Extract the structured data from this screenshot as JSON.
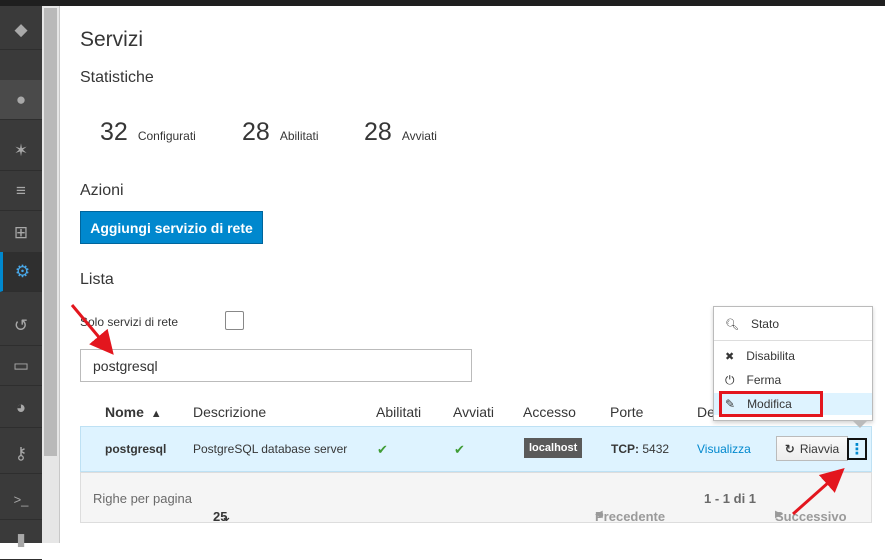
{
  "sidebar": {
    "items": [
      {
        "icon": "cube-icon",
        "glyph": "◆"
      },
      {
        "icon": "users-icon",
        "glyph": "●"
      },
      {
        "icon": "network-icon",
        "glyph": "✶"
      },
      {
        "icon": "database-icon",
        "glyph": "≡"
      },
      {
        "icon": "sitemap-icon",
        "glyph": "⊞"
      },
      {
        "icon": "gears-icon",
        "glyph": "⚙"
      },
      {
        "icon": "history-icon",
        "glyph": "↺"
      },
      {
        "icon": "drive-icon",
        "glyph": "▭"
      },
      {
        "icon": "pie-chart-icon",
        "glyph": "◕"
      },
      {
        "icon": "key-icon",
        "glyph": "⚷"
      },
      {
        "icon": "terminal-icon",
        "glyph": ">_"
      },
      {
        "icon": "document-icon",
        "glyph": "▮"
      }
    ]
  },
  "page": {
    "title": "Servizi",
    "stats_heading": "Statistiche",
    "actions_heading": "Azioni",
    "list_heading": "Lista"
  },
  "stats": [
    {
      "value": "32",
      "label": "Configurati"
    },
    {
      "value": "28",
      "label": "Abilitati"
    },
    {
      "value": "28",
      "label": "Avviati"
    }
  ],
  "actions": {
    "add_network_service": "Aggiungi servizio di rete"
  },
  "filters": {
    "network_only_label": "Solo servizi di rete",
    "search_value": "postgresql"
  },
  "table": {
    "headers": {
      "name": "Nome",
      "sort_indicator": "▲",
      "description": "Descrizione",
      "enabled": "Abilitati",
      "started": "Avviati",
      "access": "Accesso",
      "ports": "Porte",
      "details": "De"
    },
    "rows": [
      {
        "name": "postgresql",
        "description": "PostgreSQL database server",
        "enabled": "✔",
        "started": "✔",
        "access": "localhost",
        "ports_label": "TCP:",
        "ports_value": "5432",
        "details_link": "Visualizza",
        "restart": "Riavvia",
        "restart_icon": "↻",
        "kebab": "⋮"
      }
    ],
    "footer": {
      "rows_per_page_label": "Righe per pagina",
      "rows_per_page_value": "25",
      "chevron": "⌄",
      "prev": "Precedente",
      "prev_arrow": "◀",
      "range": "1 - 1 di 1",
      "next": "Successivo",
      "next_arrow": "▶"
    }
  },
  "menu": {
    "items": [
      {
        "label": "Stato",
        "glyph": "🔍︎"
      },
      {
        "label": "Disabilita",
        "glyph": "✖"
      },
      {
        "label": "Ferma",
        "glyph": "⏻"
      },
      {
        "label": "Modifica",
        "glyph": "✎"
      }
    ]
  },
  "colors": {
    "accent": "#0088ce",
    "annotation": "#e3161e",
    "selected_row": "#def3ff"
  }
}
